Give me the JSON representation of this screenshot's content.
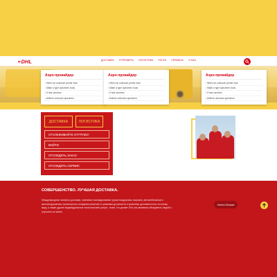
{
  "header": {
    "logo_text": "DHL",
    "nav": [
      "ДОСТАВКА",
      "ОТПРАВИТЬ",
      "ЛОГИСТИКА",
      "ПОЧТА",
      "СЕРВИСЫ",
      "О НАС"
    ]
  },
  "hero": {
    "cards": [
      {
        "title": "Аэро-провайдер",
        "items": [
          "When an unknown printer took",
          "Make a type specimen book.",
          "It has survived.",
          "Airlines unknown specimen."
        ]
      },
      {
        "title": "Аэро-провайдер",
        "items": [
          "When an unknown printer took",
          "Make a type specimen book.",
          "It has survived.",
          "Airlines unknown specimen."
        ]
      },
      {
        "title": "Аэро-провайдер",
        "items": [
          "When an unknown printer took",
          "Make a type specimen book.",
          "It has survived.",
          "Airlines unknown specimen."
        ]
      }
    ]
  },
  "services": {
    "tabs": [
      "ДОСТАВКА",
      "ЛОГИСТИКА"
    ],
    "links": [
      "ОТСЛЕЖИВАЙТЕ ОТГРУЗКУ",
      "ВОЙТИ",
      "ОТСЛЕДИТЬ ЗАКАЗ",
      "ОТСЛЕДИТЬ СЕРВИС"
    ]
  },
  "footer": {
    "title": "СОВЕРШЕНСТВО. ЛУЧШАЯ ДОСТАВКА.",
    "text": "Международные экспресс доставки, наземные экспедирование грузов воздушным, морским, автомобильным и железнодорожным транспортом; складские решения от упаковки до ремонта и хранения; доставка почты по всему миру, а также другие индивидуальные логистические услуги - всем, что делает DHL мы являемся объединять людей и улучшать их жизнь.",
    "learn_more": "Узнать больше"
  },
  "colors": {
    "brand_yellow": "#f7d046",
    "brand_red": "#d40511",
    "footer_red": "#c2161b"
  },
  "icons": {
    "search": "search-icon",
    "scroll_top": "arrow-up-icon"
  }
}
